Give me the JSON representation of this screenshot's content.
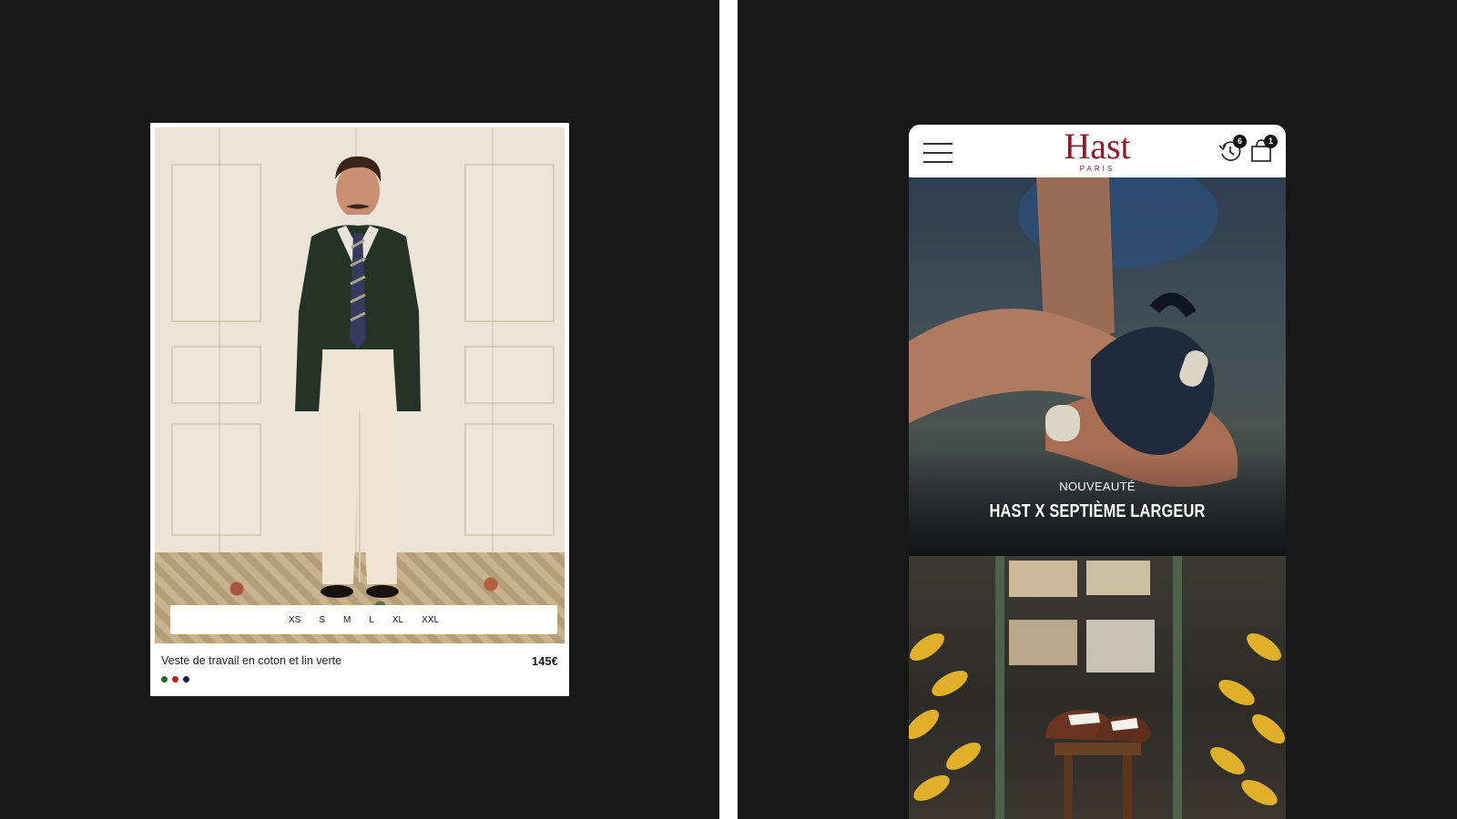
{
  "product_card": {
    "sizes": [
      "XS",
      "S",
      "M",
      "L",
      "XL",
      "XXL"
    ],
    "name": "Veste de travail en coton et lin verte",
    "price": "145€",
    "swatches": [
      "#1f6b2a",
      "#c41b22",
      "#151a55"
    ],
    "image_icon": "man-in-green-jacket-photo"
  },
  "mobile": {
    "logo": "Hast",
    "logo_sub": "PARIS",
    "menu_icon": "hamburger-menu-icon",
    "history_icon": "history-icon",
    "history_count": "6",
    "bag_icon": "shopping-bag-icon",
    "bag_count": "1",
    "hero": {
      "kicker": "NOUVEAUTÉ",
      "title": "HAST X SEPTIÈME LARGEUR",
      "image_icon": "hands-shaping-leather-photo"
    },
    "second_image_icon": "loafer-on-stool-workshop-photo"
  },
  "colors": {
    "background": "#181818",
    "brand": "#8f1a2a"
  }
}
